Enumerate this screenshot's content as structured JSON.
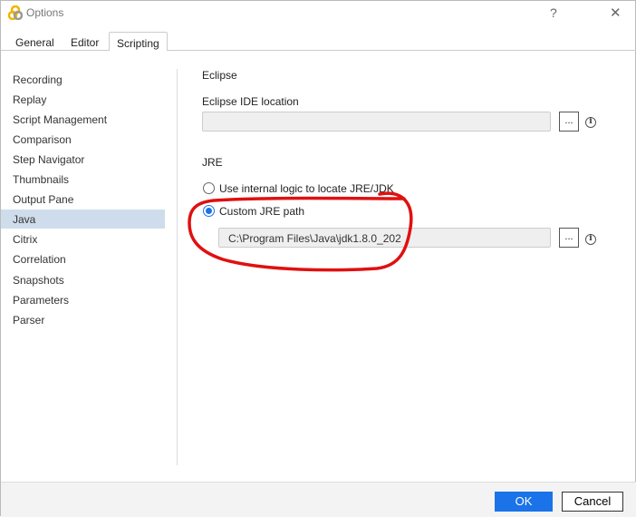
{
  "window": {
    "title": "Options",
    "help": "?",
    "close": "✕"
  },
  "tabs": [
    {
      "label": "General"
    },
    {
      "label": "Editor"
    },
    {
      "label": "Scripting",
      "active": true
    }
  ],
  "sidebar": {
    "items": [
      {
        "label": "Recording"
      },
      {
        "label": "Replay"
      },
      {
        "label": "Script Management"
      },
      {
        "label": "Comparison"
      },
      {
        "label": "Step Navigator"
      },
      {
        "label": "Thumbnails"
      },
      {
        "label": "Output Pane"
      },
      {
        "label": "Java",
        "selected": true
      },
      {
        "label": "Citrix"
      },
      {
        "label": "Correlation"
      },
      {
        "label": "Snapshots"
      },
      {
        "label": "Parameters"
      },
      {
        "label": "Parser"
      }
    ]
  },
  "main": {
    "eclipse": {
      "heading": "Eclipse",
      "location_label": "Eclipse IDE location",
      "location_value": "",
      "browse": "...",
      "info": "i"
    },
    "jre": {
      "heading": "JRE",
      "option_internal": "Use internal logic to locate JRE/JDK",
      "option_custom": "Custom JRE path",
      "selected": "custom",
      "path_value": "C:\\Program Files\\Java\\jdk1.8.0_202",
      "browse": "...",
      "info": "i"
    }
  },
  "footer": {
    "ok": "OK",
    "cancel": "Cancel"
  },
  "colors": {
    "accent": "#1a73e8",
    "selection": "#cfdceb",
    "annotation": "#e01010"
  }
}
